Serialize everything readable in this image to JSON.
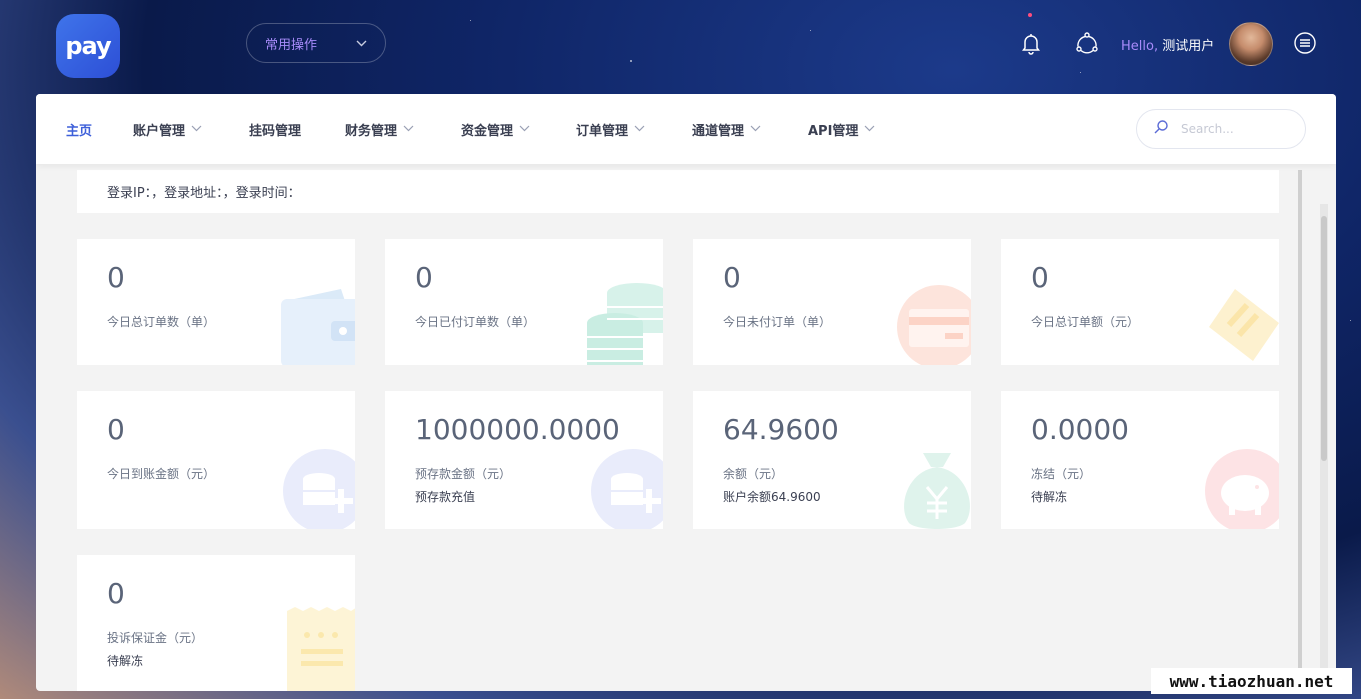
{
  "header": {
    "logo_text": "pay",
    "quick_ops_label": "常用操作",
    "hello_prefix": "Hello,",
    "user_name": "测试用户"
  },
  "nav": {
    "items": [
      {
        "label": "主页",
        "has_caret": false,
        "active": true
      },
      {
        "label": "账户管理",
        "has_caret": true
      },
      {
        "label": "挂码管理",
        "has_caret": false
      },
      {
        "label": "财务管理",
        "has_caret": true
      },
      {
        "label": "资金管理",
        "has_caret": true
      },
      {
        "label": "订单管理",
        "has_caret": true
      },
      {
        "label": "通道管理",
        "has_caret": true
      },
      {
        "label": "API管理",
        "has_caret": true
      }
    ],
    "search_placeholder": "Search..."
  },
  "login_info": "登录IP：，登录地址：，登录时间：",
  "stats": [
    {
      "value": "0",
      "label": "今日总订单数（单）",
      "sub": ""
    },
    {
      "value": "0",
      "label": "今日已付订单数（单）",
      "sub": ""
    },
    {
      "value": "0",
      "label": "今日未付订单（单）",
      "sub": ""
    },
    {
      "value": "0",
      "label": "今日总订单额（元）",
      "sub": ""
    },
    {
      "value": "0",
      "label": "今日到账金额（元）",
      "sub": ""
    },
    {
      "value": "1000000.0000",
      "label": "预存款金额（元）",
      "sub": "预存款充值"
    },
    {
      "value": "64.9600",
      "label": "余额（元）",
      "sub": "账户余额64.9600"
    },
    {
      "value": "0.0000",
      "label": "冻结（元）",
      "sub": "待解冻"
    },
    {
      "value": "0",
      "label": "投诉保证金（元）",
      "sub": "待解冻"
    }
  ],
  "watermark": "www.tiaozhuan.net",
  "colors": {
    "accent": "#3d5fd9",
    "hello": "#a78bfa"
  }
}
